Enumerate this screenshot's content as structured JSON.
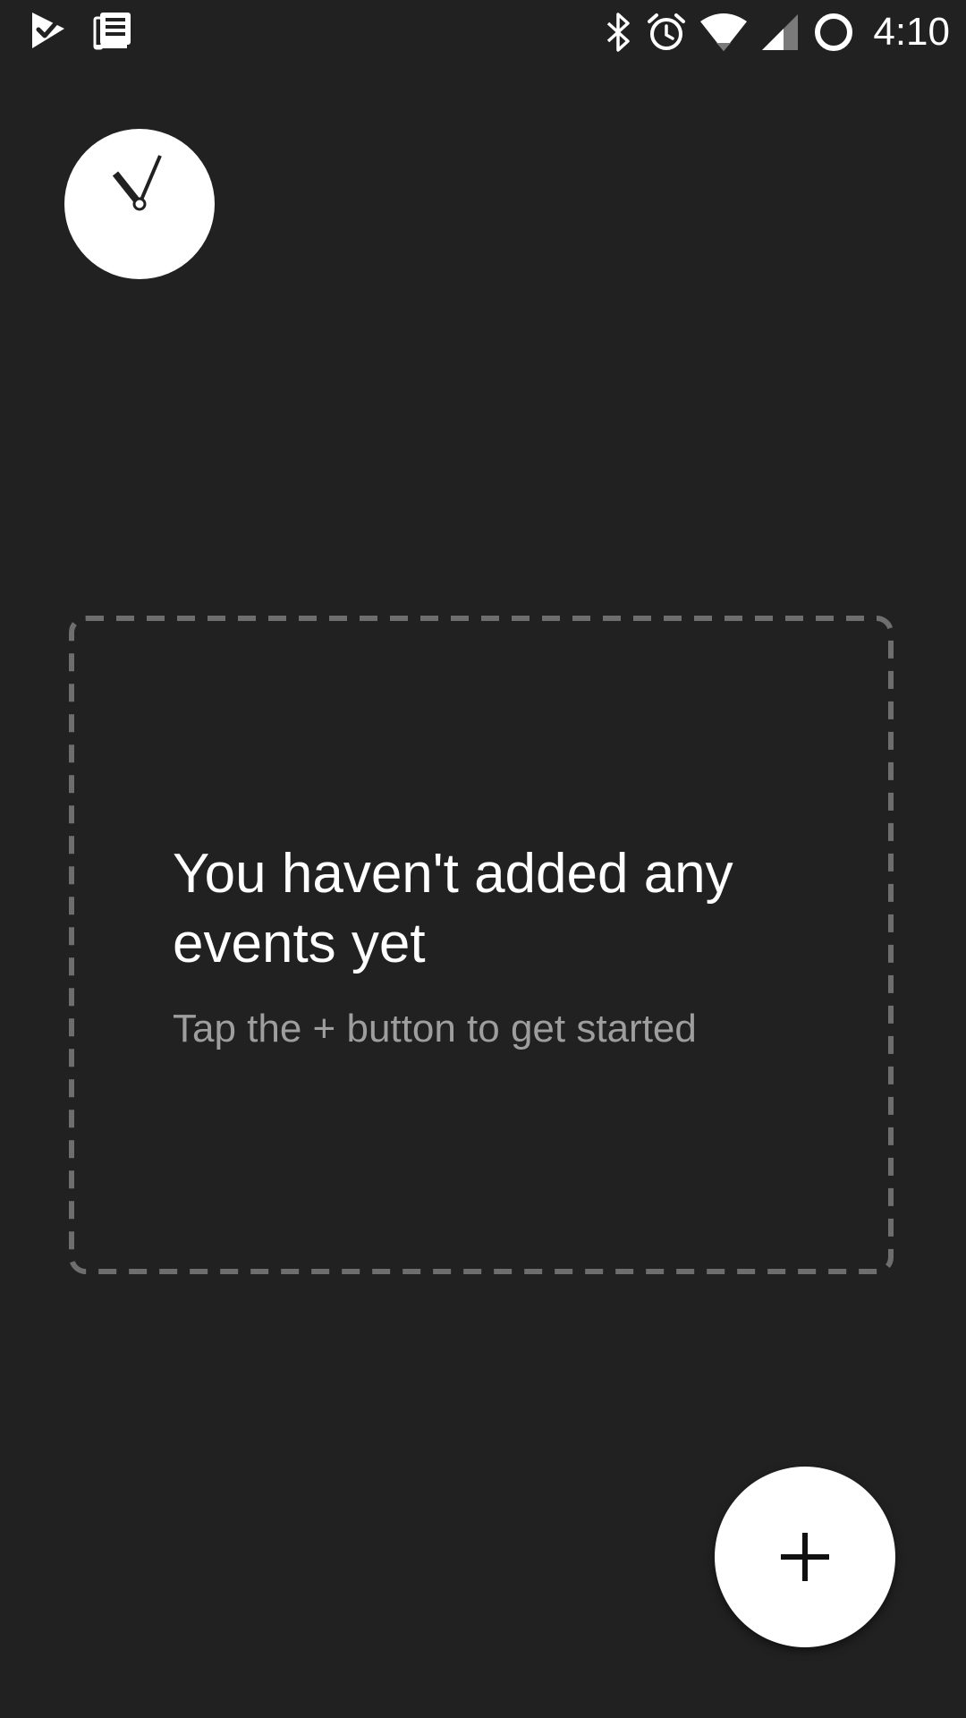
{
  "status_bar": {
    "left_icons": [
      "tasks-check-icon",
      "news-icon"
    ],
    "right_icons": [
      "bluetooth-icon",
      "alarm-icon",
      "wifi-icon",
      "cell-signal-icon",
      "battery-ring-icon"
    ],
    "time": "4:10"
  },
  "header": {
    "avatar_icon": "clock-icon"
  },
  "empty_state": {
    "title": "You haven't added any events yet",
    "subtitle": "Tap the + button to get started"
  },
  "fab": {
    "icon": "plus-icon"
  },
  "colors": {
    "background": "#212121",
    "surface": "#ffffff",
    "dashed_border": "#6e6e6e",
    "subtitle_text": "#9e9e9e"
  }
}
